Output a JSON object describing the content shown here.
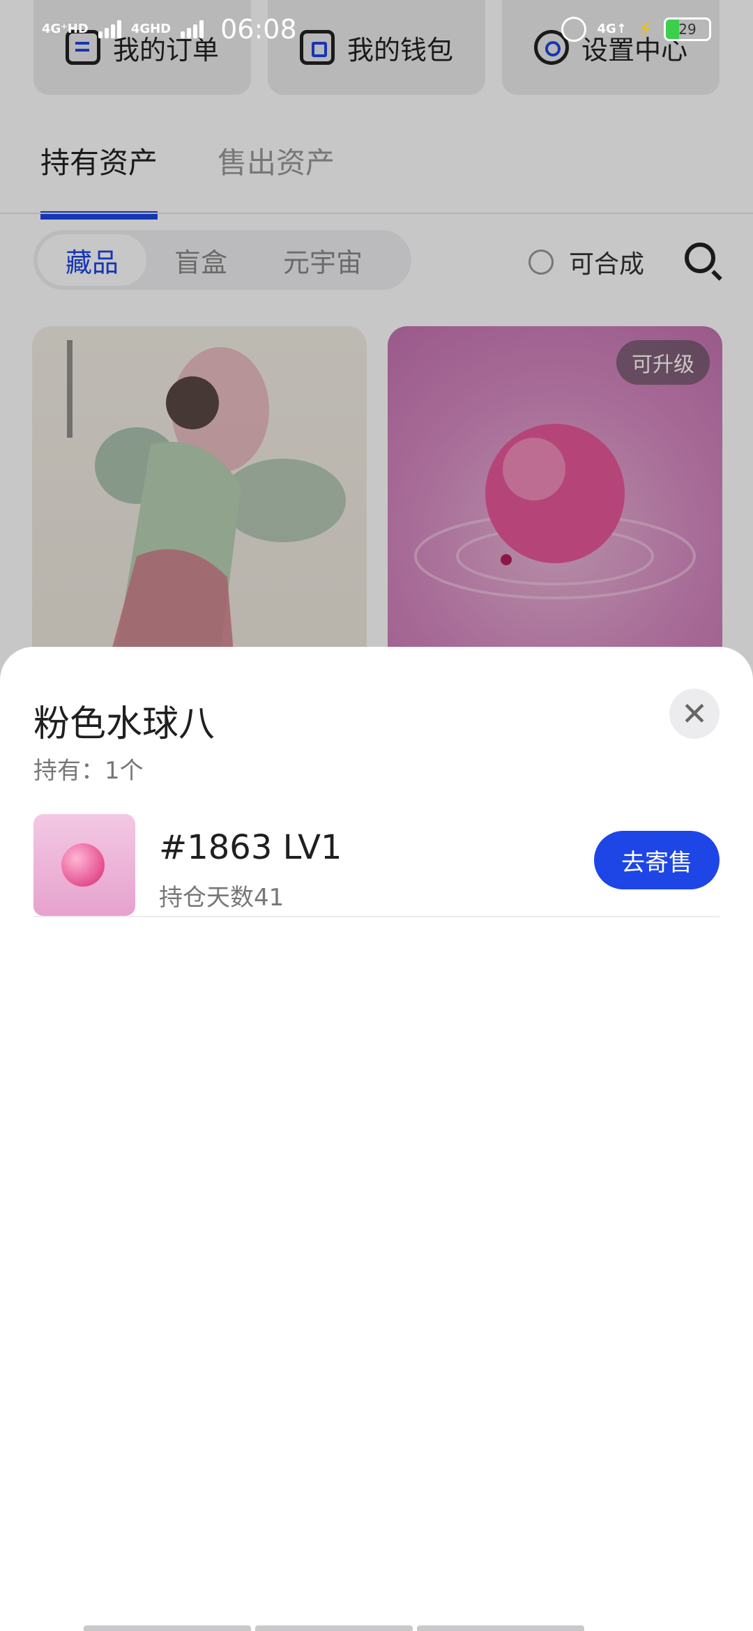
{
  "status_bar": {
    "network_1": "4G⁺HD",
    "network_2": "4GHD",
    "time": "06:08",
    "network_3": "4G↑",
    "battery": "29"
  },
  "shortcuts": [
    {
      "label": "我的订单",
      "icon": "order-icon"
    },
    {
      "label": "我的钱包",
      "icon": "wallet-icon"
    },
    {
      "label": "设置中心",
      "icon": "settings-icon"
    }
  ],
  "tabs": [
    {
      "label": "持有资产",
      "active": true
    },
    {
      "label": "售出资产",
      "active": false
    }
  ],
  "filters": [
    {
      "label": "藏品",
      "active": true
    },
    {
      "label": "盲盒",
      "active": false
    },
    {
      "label": "元宇宙",
      "active": false
    }
  ],
  "merge_label": "可合成",
  "tiles": [
    {
      "image": "watercolor-girl-lotus",
      "badge": ""
    },
    {
      "image": "pink-water-balloon",
      "badge": "可升级"
    }
  ],
  "sheet": {
    "title": "粉色水球八",
    "held": "持有：1个",
    "item": {
      "id": "#1863 LV1",
      "days": "持仓天数41",
      "action": "去寄售"
    }
  },
  "colors": {
    "accent": "#1e46e6",
    "text_primary": "#222222",
    "text_secondary": "#777777"
  }
}
